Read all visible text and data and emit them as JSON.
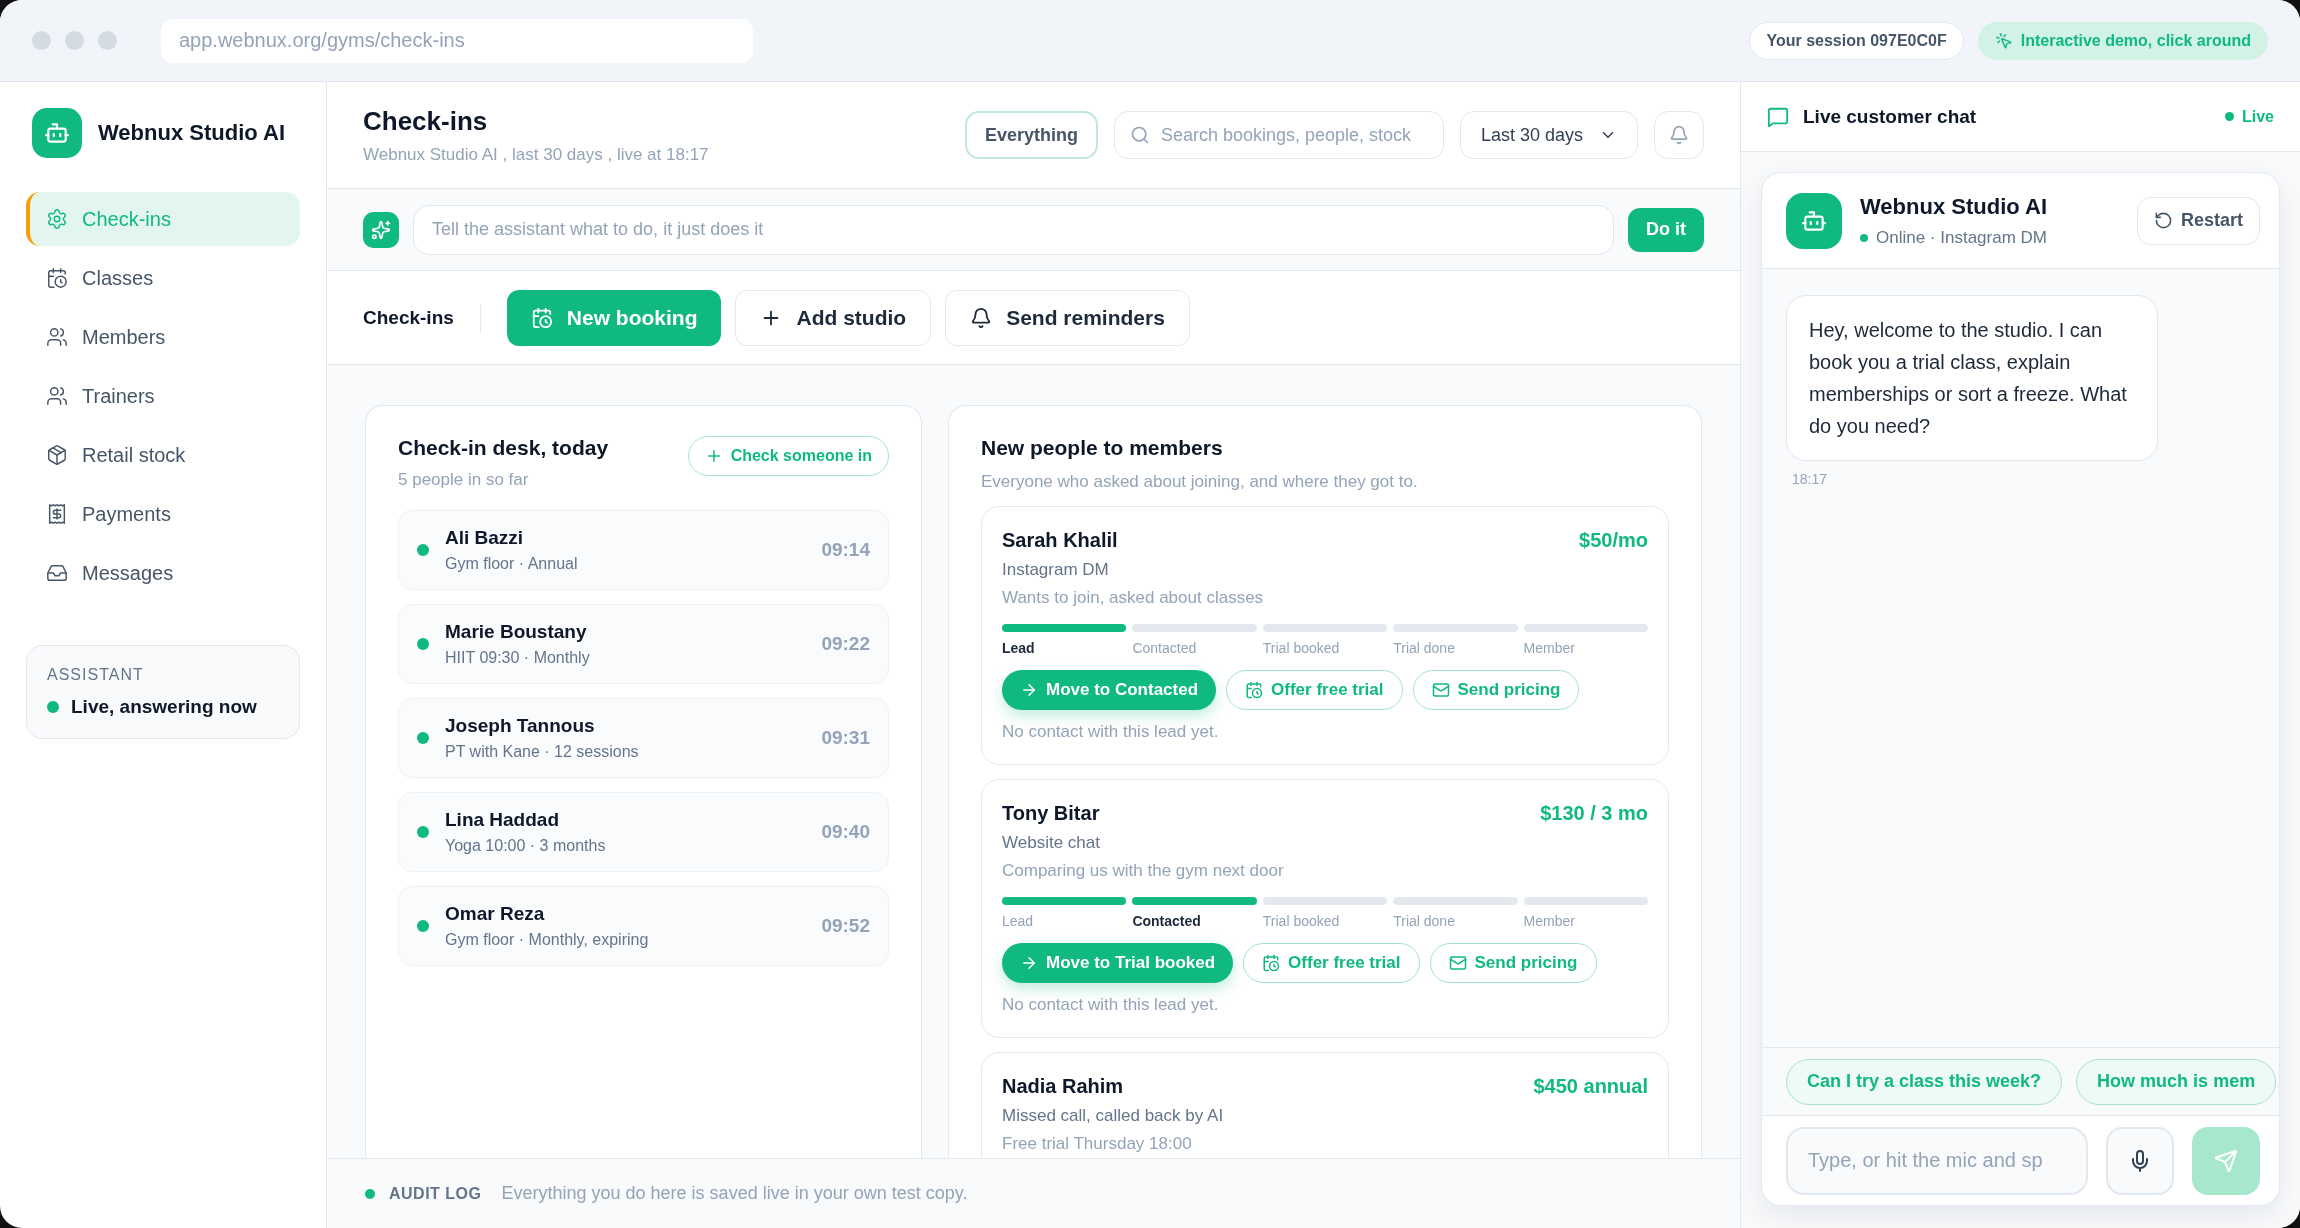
{
  "browser": {
    "url": "app.webnux.org/gyms/check-ins",
    "session": "Your session 097E0C0F",
    "demo": "Interactive demo, click around"
  },
  "sidebar": {
    "brand": "Webnux Studio AI",
    "items": [
      {
        "label": "Check-ins",
        "selected": true
      },
      {
        "label": "Classes",
        "selected": false
      },
      {
        "label": "Members",
        "selected": false
      },
      {
        "label": "Trainers",
        "selected": false
      },
      {
        "label": "Retail stock",
        "selected": false
      },
      {
        "label": "Payments",
        "selected": false
      },
      {
        "label": "Messages",
        "selected": false
      }
    ],
    "assistant": {
      "label": "ASSISTANT",
      "status": "Live, answering now"
    }
  },
  "header": {
    "title": "Check-ins",
    "subtitle": "Webnux Studio AI , last 30 days , live at 18:17",
    "filter": "Everything",
    "search": {
      "placeholder": "Search bookings, people, stock"
    },
    "range": "Last 30 days"
  },
  "assistant_bar": {
    "placeholder": "Tell the assistant what to do, it just does it",
    "button": "Do it"
  },
  "toolbar": {
    "title": "Check-ins",
    "buttons": [
      {
        "label": "New booking",
        "kind": "primary"
      },
      {
        "label": "Add studio",
        "kind": "add"
      },
      {
        "label": "Send reminders",
        "kind": "remind"
      }
    ]
  },
  "checkin_desk": {
    "title": "Check-in desk, today",
    "subtitle": "5 people in so far",
    "button": "Check someone in",
    "rows": [
      {
        "name": "Ali Bazzi",
        "detail": "Gym floor · Annual",
        "time": "09:14"
      },
      {
        "name": "Marie Boustany",
        "detail": "HIIT 09:30 · Monthly",
        "time": "09:22"
      },
      {
        "name": "Joseph Tannous",
        "detail": "PT with Kane · 12 sessions",
        "time": "09:31"
      },
      {
        "name": "Lina Haddad",
        "detail": "Yoga 10:00 · 3 months",
        "time": "09:40"
      },
      {
        "name": "Omar Reza",
        "detail": "Gym floor · Monthly, expiring",
        "time": "09:52"
      }
    ]
  },
  "pipeline": {
    "title": "New people to members",
    "subtitle": "Everyone who asked about joining, and where they got to.",
    "leads": [
      {
        "name": "Sarah Khalil",
        "price": "$50/mo",
        "source": "Instagram DM",
        "note": "Wants to join, asked about classes",
        "stages": [
          {
            "label": "Lead",
            "filled": true,
            "selected": true
          },
          {
            "label": "Contacted",
            "filled": false,
            "selected": false
          },
          {
            "label": "Trial booked",
            "filled": false,
            "selected": false
          },
          {
            "label": "Trial done",
            "filled": false,
            "selected": false
          },
          {
            "label": "Member",
            "filled": false,
            "selected": false
          }
        ],
        "actions": [
          {
            "label": "Move to Contacted",
            "kind": "advance"
          },
          {
            "label": "Offer free trial",
            "kind": "trial"
          },
          {
            "label": "Send pricing",
            "kind": "pricing"
          }
        ],
        "footnote": "No contact with this lead yet."
      },
      {
        "name": "Tony Bitar",
        "price": "$130 / 3 mo",
        "source": "Website chat",
        "note": "Comparing us with the gym next door",
        "stages": [
          {
            "label": "Lead",
            "filled": true,
            "selected": false
          },
          {
            "label": "Contacted",
            "filled": true,
            "selected": true
          },
          {
            "label": "Trial booked",
            "filled": false,
            "selected": false
          },
          {
            "label": "Trial done",
            "filled": false,
            "selected": false
          },
          {
            "label": "Member",
            "filled": false,
            "selected": false
          }
        ],
        "actions": [
          {
            "label": "Move to Trial booked",
            "kind": "advance"
          },
          {
            "label": "Offer free trial",
            "kind": "trial"
          },
          {
            "label": "Send pricing",
            "kind": "pricing"
          }
        ],
        "footnote": "No contact with this lead yet."
      },
      {
        "name": "Nadia Rahim",
        "price": "$450 annual",
        "source": "Missed call, called back by AI",
        "note": "Free trial Thursday 18:00"
      }
    ]
  },
  "footer": {
    "label": "AUDIT LOG",
    "text": "Everything you do here is saved live in your own test copy."
  },
  "chat": {
    "title": "Live customer chat",
    "status": "Live",
    "bot": {
      "name": "Webnux Studio AI",
      "status": "Online · Instagram DM"
    },
    "restart": "Restart",
    "messages": [
      {
        "text": "Hey, welcome to the studio. I can book you a trial class, explain memberships or sort a freeze. What do you need?",
        "time": "18:17"
      }
    ],
    "suggestions": [
      "Can I try a class this week?",
      "How much is mem"
    ],
    "input": {
      "placeholder": "Type, or hit the mic and sp"
    },
    "send": {
      "disabled": true
    }
  }
}
